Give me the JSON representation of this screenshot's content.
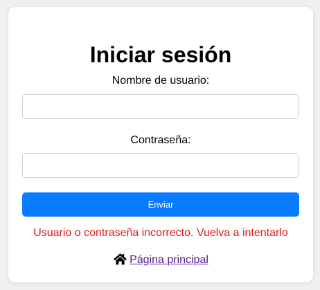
{
  "login": {
    "title": "Iniciar sesión",
    "username_label": "Nombre de usuario:",
    "username_value": "",
    "password_label": "Contraseña:",
    "password_value": "",
    "submit_label": "Enviar",
    "error_message": "Usuario o contraseña incorrecto. Vuelva a intentarlo"
  },
  "home": {
    "icon": "home-icon",
    "link_label": "Página principal"
  },
  "colors": {
    "button": "#0a7cff",
    "error": "#e01818",
    "link_visited": "#551a8b"
  }
}
